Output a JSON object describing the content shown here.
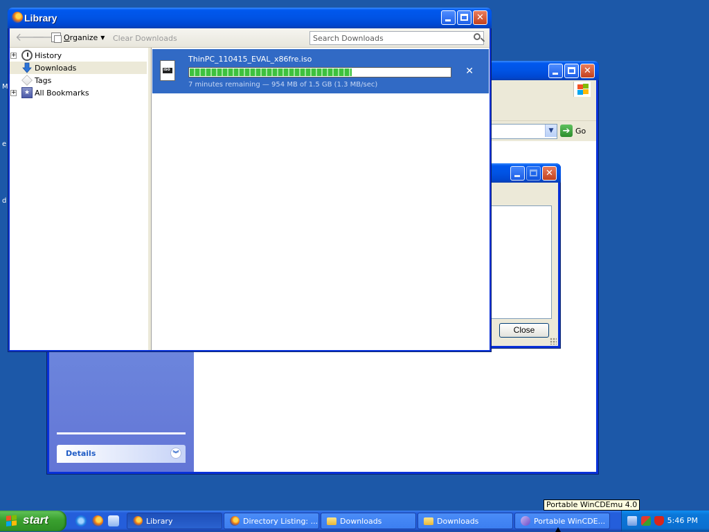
{
  "desktop": {
    "edge_letters": [
      "M",
      "e",
      "d"
    ]
  },
  "back_window": {
    "address_go_label": "Go",
    "details_panel_title": "Details"
  },
  "dialog": {
    "close_label": "Close"
  },
  "library": {
    "title": "Library",
    "toolbar": {
      "organize_label": "Organize",
      "clear_downloads_label": "Clear Downloads",
      "search_placeholder": "Search Downloads"
    },
    "tree": [
      {
        "label": "History",
        "icon": "clock-icon",
        "expandable": true
      },
      {
        "label": "Downloads",
        "icon": "download-arrow-icon",
        "expandable": false,
        "selected": true
      },
      {
        "label": "Tags",
        "icon": "tag-icon",
        "expandable": false
      },
      {
        "label": "All Bookmarks",
        "icon": "bookmarks-star-icon",
        "expandable": true
      }
    ],
    "download": {
      "filename": "ThinPC_110415_EVAL_x86fre.iso",
      "status": "7 minutes remaining — 954 MB of 1.5 GB (1.3 MB/sec)",
      "progress_fraction": 0.62,
      "cancel_glyph": "✕"
    }
  },
  "taskbar": {
    "start_label": "start",
    "quick_launch": [
      "internet-explorer-icon",
      "firefox-icon",
      "show-desktop-icon"
    ],
    "buttons": [
      {
        "label": "Library",
        "icon": "firefox-icon",
        "active": true
      },
      {
        "label": "Directory Listing: ...",
        "icon": "firefox-icon",
        "active": false
      },
      {
        "label": "Downloads",
        "icon": "folder-icon",
        "active": false
      },
      {
        "label": "Downloads",
        "icon": "folder-icon",
        "active": false
      },
      {
        "label": "Portable WinCDE...",
        "icon": "wincdemu-icon",
        "active": false
      }
    ],
    "tray_icons": [
      "network-icon",
      "security-shield-icon",
      "antivirus-shield-icon"
    ],
    "clock": "5:46 PM",
    "tooltip": "Portable WinCDEmu 4.0"
  },
  "colors": {
    "desktop_bg": "#1c58a8",
    "title_bar": "#0058ee",
    "selection": "#316ac5",
    "progress_green": "#3ec13e",
    "start_green": "#3aa02f"
  }
}
